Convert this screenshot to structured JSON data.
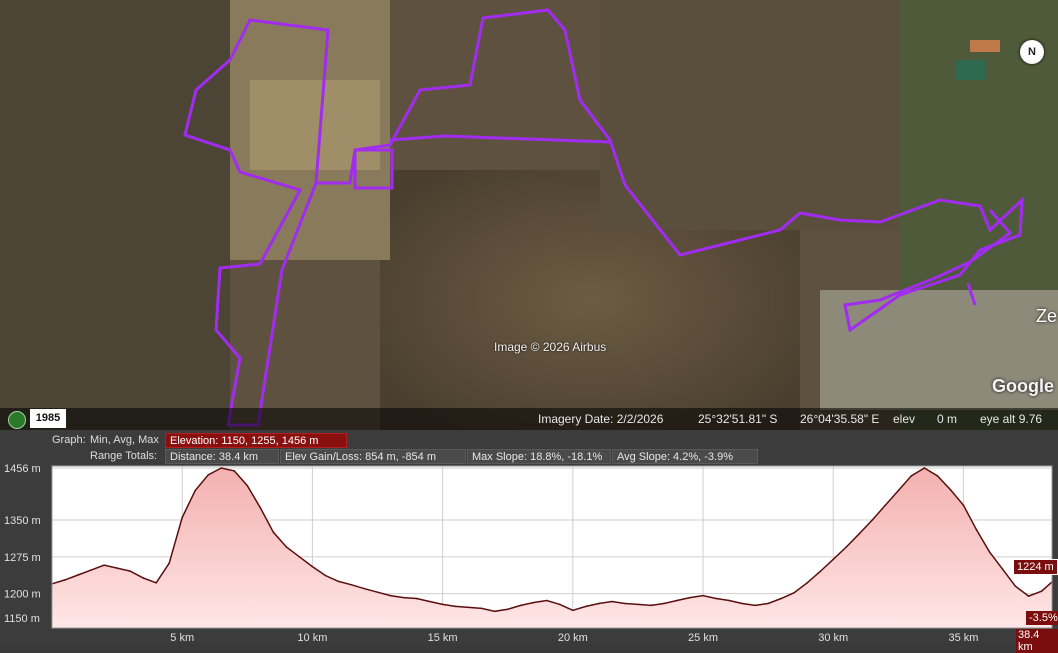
{
  "map": {
    "attribution": "Image © 2026 Airbus",
    "brand": "Google",
    "place_label": "Ze",
    "compass": "N"
  },
  "statusbar": {
    "year": "1985",
    "imagery_date": "Imagery Date: 2/2/2026",
    "lat": "25°32'51.81\" S",
    "lon": "26°04'35.58\" E",
    "elev_label": "elev",
    "elev_value": "0 m",
    "eye_alt": "eye alt  9.76"
  },
  "profile": {
    "graph_label": "Graph:",
    "graph_mode": "Min, Avg, Max",
    "elevation": "Elevation: 1150, 1255, 1456 m",
    "range_label": "Range Totals:",
    "distance": "Distance: 38.4 km",
    "elev_gain": "Elev Gain/Loss: 854 m, -854 m",
    "max_slope": "Max Slope: 18.8%, -18.1%",
    "avg_slope": "Avg Slope: 4.2%, -3.9%",
    "cursor_elev": "1224 m",
    "cursor_slope": "-3.5%",
    "end_label": "38.4 km"
  },
  "chart_data": {
    "type": "area",
    "xlabel": "",
    "ylabel": "",
    "x_ticks": [
      "5 km",
      "10 km",
      "15 km",
      "20 km",
      "25 km",
      "30 km",
      "35 km"
    ],
    "x_tick_values": [
      5,
      10,
      15,
      20,
      25,
      30,
      35
    ],
    "y_ticks": [
      "1456 m",
      "1350 m",
      "1275 m",
      "1200 m",
      "1150 m"
    ],
    "y_tick_values": [
      1456,
      1350,
      1275,
      1200,
      1150
    ],
    "xlim": [
      0,
      38.4
    ],
    "ylim": [
      1130,
      1460
    ],
    "colors": {
      "fill_top": "#f4b0b0",
      "fill_bottom": "#ffe6e6",
      "line": "#5a0f0f",
      "grid": "#cfcfcf"
    },
    "series": [
      {
        "x": [
          0,
          0.5,
          1,
          1.5,
          2,
          2.5,
          3,
          3.5,
          4,
          4.5,
          5,
          5.5,
          6,
          6.5,
          7,
          7.5,
          8,
          8.5,
          9,
          9.5,
          10,
          10.5,
          11,
          11.5,
          12,
          12.5,
          13,
          13.5,
          14,
          14.5,
          15,
          15.5,
          16,
          16.5,
          17,
          17.5,
          18,
          18.5,
          19,
          19.5,
          20,
          20.5,
          21,
          21.5,
          22,
          22.5,
          23,
          23.5,
          24,
          24.5,
          25,
          25.5,
          26,
          26.5,
          27,
          27.5,
          28,
          28.5,
          29,
          29.5,
          30,
          30.5,
          31,
          31.5,
          32,
          32.5,
          33,
          33.5,
          34,
          34.5,
          35,
          35.5,
          36,
          36.5,
          37,
          37.5,
          38,
          38.4
        ],
        "y": [
          1220,
          1228,
          1238,
          1248,
          1258,
          1252,
          1246,
          1232,
          1222,
          1262,
          1355,
          1410,
          1442,
          1456,
          1450,
          1420,
          1375,
          1325,
          1295,
          1275,
          1255,
          1237,
          1225,
          1218,
          1210,
          1203,
          1196,
          1192,
          1190,
          1184,
          1178,
          1174,
          1172,
          1170,
          1164,
          1168,
          1176,
          1182,
          1186,
          1178,
          1166,
          1174,
          1180,
          1184,
          1180,
          1178,
          1176,
          1180,
          1186,
          1192,
          1196,
          1190,
          1186,
          1180,
          1176,
          1180,
          1190,
          1202,
          1222,
          1245,
          1270,
          1295,
          1322,
          1350,
          1380,
          1410,
          1440,
          1456,
          1440,
          1412,
          1380,
          1330,
          1285,
          1250,
          1215,
          1195,
          1205,
          1224
        ]
      }
    ]
  }
}
